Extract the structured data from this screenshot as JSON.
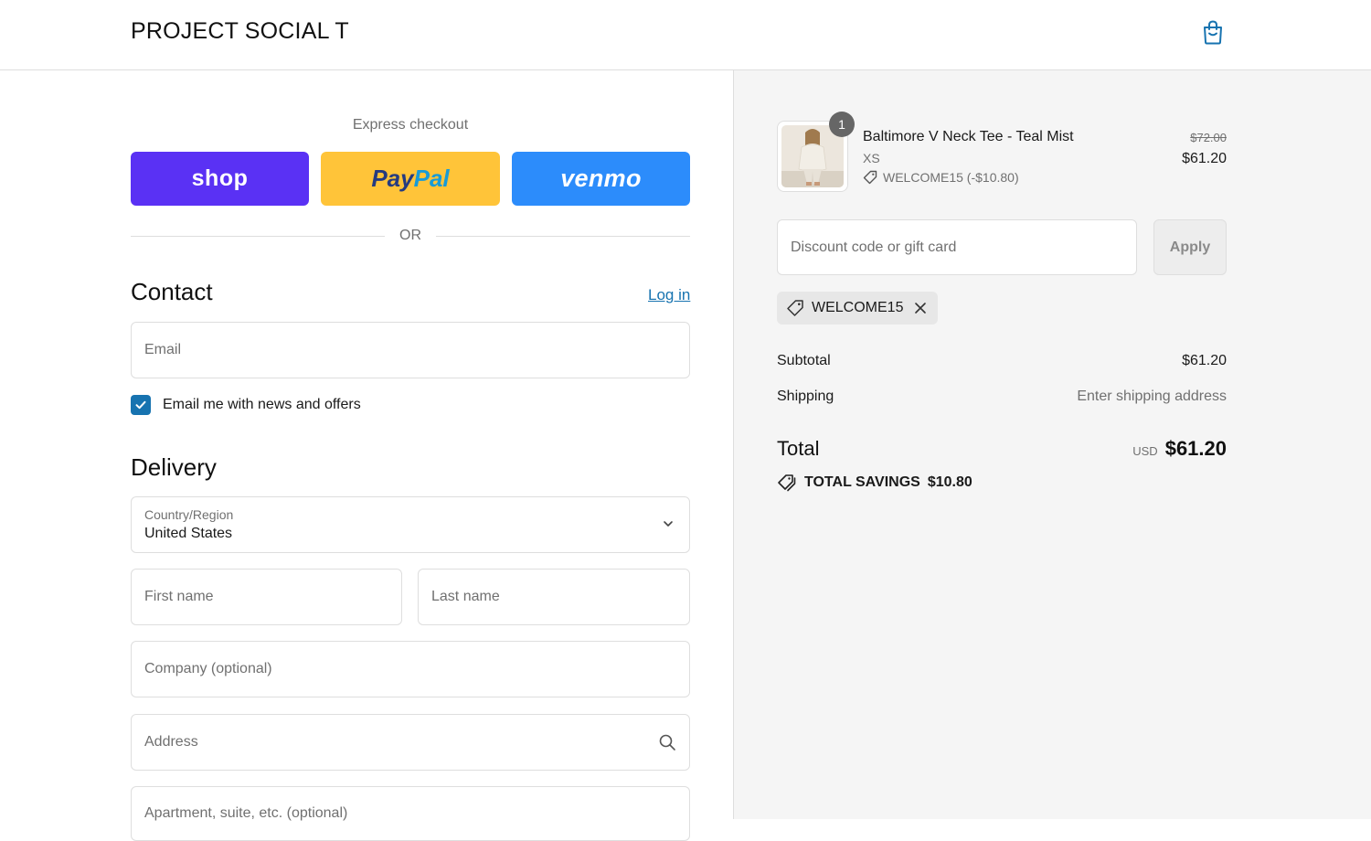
{
  "header": {
    "brand": "PROJECT SOCIAL T",
    "cart_icon": "shopping-bag-icon"
  },
  "express": {
    "title": "Express checkout",
    "shop_label": "shop",
    "paypal_label_1": "Pay",
    "paypal_label_2": "Pal",
    "venmo_label": "venmo",
    "or_text": "OR",
    "colors": {
      "shop": "#5a31f4",
      "paypal": "#ffc439",
      "venmo": "#2c8cfb"
    }
  },
  "contact": {
    "title": "Contact",
    "login_label": "Log in",
    "email_placeholder": "Email",
    "email_value": "",
    "newsletter_label": "Email me with news and offers",
    "newsletter_checked": true
  },
  "delivery": {
    "title": "Delivery",
    "country_label": "Country/Region",
    "country_value": "United States",
    "first_name_placeholder": "First name",
    "last_name_placeholder": "Last name",
    "company_placeholder": "Company (optional)",
    "address_placeholder": "Address",
    "apartment_placeholder": "Apartment, suite, etc. (optional)"
  },
  "summary": {
    "item": {
      "quantity": "1",
      "name": "Baltimore V Neck Tee - Teal Mist",
      "variant": "XS",
      "discount": "WELCOME15 (-$10.80)",
      "price_original": "$72.00",
      "price_final": "$61.20"
    },
    "discount_placeholder": "Discount code or gift card",
    "apply_label": "Apply",
    "applied_code": "WELCOME15",
    "subtotal_label": "Subtotal",
    "subtotal_value": "$61.20",
    "shipping_label": "Shipping",
    "shipping_value": "Enter shipping address",
    "total_label": "Total",
    "total_currency": "USD",
    "total_value": "$61.20",
    "savings_label": "TOTAL SAVINGS",
    "savings_value": "$10.80"
  },
  "colors": {
    "accent": "#1773b0",
    "border": "#dedede",
    "summary_bg": "#f5f5f5"
  }
}
